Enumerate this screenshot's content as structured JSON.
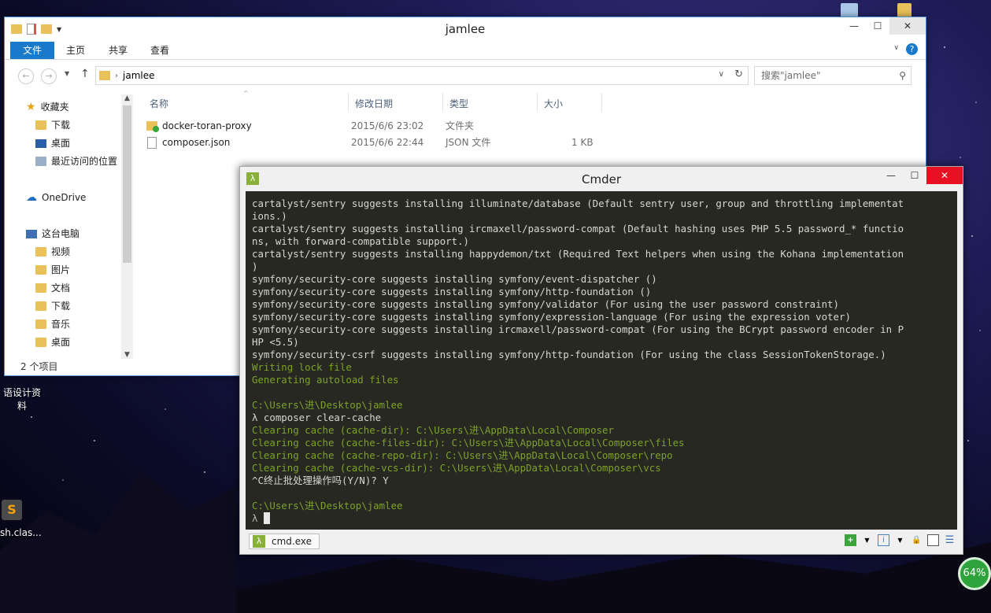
{
  "explorer": {
    "title": "jamlee",
    "ribbon_tabs": [
      "文件",
      "主页",
      "共享",
      "查看"
    ],
    "address": "jamlee",
    "search_placeholder": "搜索\"jamlee\"",
    "sidebar": [
      {
        "label": "收藏夹",
        "icon": "star-icon"
      },
      {
        "label": "下载",
        "icon": "download-folder-icon"
      },
      {
        "label": "桌面",
        "icon": "desktop-icon"
      },
      {
        "label": "最近访问的位置",
        "icon": "recent-places-icon"
      },
      {
        "label": "OneDrive",
        "icon": "cloud-icon"
      },
      {
        "label": "这台电脑",
        "icon": "computer-icon"
      },
      {
        "label": "视频",
        "icon": "folder-icon"
      },
      {
        "label": "图片",
        "icon": "folder-icon"
      },
      {
        "label": "文档",
        "icon": "folder-icon"
      },
      {
        "label": "下载",
        "icon": "folder-icon"
      },
      {
        "label": "音乐",
        "icon": "folder-icon"
      },
      {
        "label": "桌面",
        "icon": "folder-icon"
      }
    ],
    "columns": [
      "名称",
      "修改日期",
      "类型",
      "大小"
    ],
    "files": [
      {
        "name": "docker-toran-proxy",
        "date": "2015/6/6 23:02",
        "type": "文件夹",
        "size": "",
        "icon": "folder-synced-icon"
      },
      {
        "name": "composer.json",
        "date": "2015/6/6 22:44",
        "type": "JSON 文件",
        "size": "1 KB",
        "icon": "file-icon"
      }
    ],
    "status": "2 个项目"
  },
  "cmder": {
    "title": "Cmder",
    "tab_label": "cmd.exe",
    "lines": [
      {
        "text": "cartalyst/sentry suggests installing illuminate/database (Default sentry user, group and throttling implementat",
        "color": "white"
      },
      {
        "text": "ions.)",
        "color": "white"
      },
      {
        "text": "cartalyst/sentry suggests installing ircmaxell/password-compat (Default hashing uses PHP 5.5 password_* functio",
        "color": "white"
      },
      {
        "text": "ns, with forward-compatible support.)",
        "color": "white"
      },
      {
        "text": "cartalyst/sentry suggests installing happydemon/txt (Required Text helpers when using the Kohana implementation",
        "color": "white"
      },
      {
        "text": ")",
        "color": "white"
      },
      {
        "text": "symfony/security-core suggests installing symfony/event-dispatcher ()",
        "color": "white"
      },
      {
        "text": "symfony/security-core suggests installing symfony/http-foundation ()",
        "color": "white"
      },
      {
        "text": "symfony/security-core suggests installing symfony/validator (For using the user password constraint)",
        "color": "white"
      },
      {
        "text": "symfony/security-core suggests installing symfony/expression-language (For using the expression voter)",
        "color": "white"
      },
      {
        "text": "symfony/security-core suggests installing ircmaxell/password-compat (For using the BCrypt password encoder in P",
        "color": "white"
      },
      {
        "text": "HP <5.5)",
        "color": "white"
      },
      {
        "text": "symfony/security-csrf suggests installing symfony/http-foundation (For using the class SessionTokenStorage.)",
        "color": "white"
      },
      {
        "text": "Writing lock file",
        "color": "green"
      },
      {
        "text": "Generating autoload files",
        "color": "green"
      },
      {
        "text": "",
        "color": "white"
      },
      {
        "text": "C:\\Users\\进\\Desktop\\jamlee",
        "color": "green"
      },
      {
        "text": "λ composer clear-cache",
        "color": "white"
      },
      {
        "text": "Clearing cache (cache-dir): C:\\Users\\进\\AppData\\Local\\Composer",
        "color": "green"
      },
      {
        "text": "Clearing cache (cache-files-dir): C:\\Users\\进\\AppData\\Local\\Composer\\files",
        "color": "green"
      },
      {
        "text": "Clearing cache (cache-repo-dir): C:\\Users\\进\\AppData\\Local\\Composer\\repo",
        "color": "green"
      },
      {
        "text": "Clearing cache (cache-vcs-dir): C:\\Users\\进\\AppData\\Local\\Composer\\vcs",
        "color": "green"
      },
      {
        "text": "^C终止批处理操作吗(Y/N)? Y",
        "color": "white"
      },
      {
        "text": "",
        "color": "white"
      },
      {
        "text": "C:\\Users\\进\\Desktop\\jamlee",
        "color": "green"
      }
    ],
    "prompt": "λ "
  },
  "desktop": {
    "icon1_label_line1": "语设计资",
    "icon1_label_line2": "料",
    "icon2_label": "sh.clas..."
  },
  "battery": "64%",
  "colors": {
    "terminal_bg": "#272822",
    "terminal_green": "#7ca22a",
    "ribbon_file": "#1979ca"
  }
}
